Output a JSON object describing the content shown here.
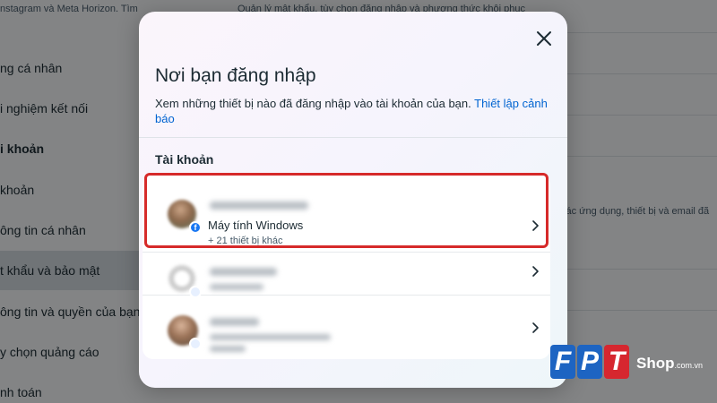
{
  "background": {
    "top_left_text": "nstagram và Meta Horizon. Tìm",
    "top_right_text": "Quản lý mật khẩu, tùy chọn đăng nhập và phương thức khôi phục",
    "sidebar_items": [
      {
        "label": "ng cá nhân",
        "selected": false,
        "bold": false
      },
      {
        "label": "i nghiệm kết nối",
        "selected": false,
        "bold": false
      },
      {
        "label": "i khoản",
        "selected": false,
        "bold": true
      },
      {
        "label": "khoản",
        "selected": false,
        "bold": false
      },
      {
        "label": "ông tin cá nhân",
        "selected": false,
        "bold": false
      },
      {
        "label": "t khẩu và bảo mật",
        "selected": true,
        "bold": false
      },
      {
        "label": "ông tin và quyền của bạn",
        "selected": false,
        "bold": false
      },
      {
        "label": "y chọn quảng cáo",
        "selected": false,
        "bold": false
      },
      {
        "label": "nh toán",
        "selected": false,
        "bold": false
      }
    ],
    "right_text": "các ứng dụng, thiết bị và email đã"
  },
  "modal": {
    "title": "Nơi bạn đăng nhập",
    "description": "Xem những thiết bị nào đã đăng nhập vào tài khoản của bạn.",
    "description_link": "Thiết lập cảnh báo",
    "close_icon": "close-icon",
    "section_label": "Tài khoản",
    "accounts": [
      {
        "device": "Máy tính Windows",
        "other_devices": "+ 21 thiết bị khác",
        "highlighted": true
      },
      {
        "highlighted": false
      },
      {
        "highlighted": false
      }
    ]
  },
  "colors": {
    "link": "#0064d1",
    "highlight_border": "#d62a2a",
    "facebook_blue": "#1877f2"
  },
  "watermark": {
    "letters": [
      "F",
      "P",
      "T"
    ],
    "brand": "Shop",
    "domain": ".com.vn"
  }
}
